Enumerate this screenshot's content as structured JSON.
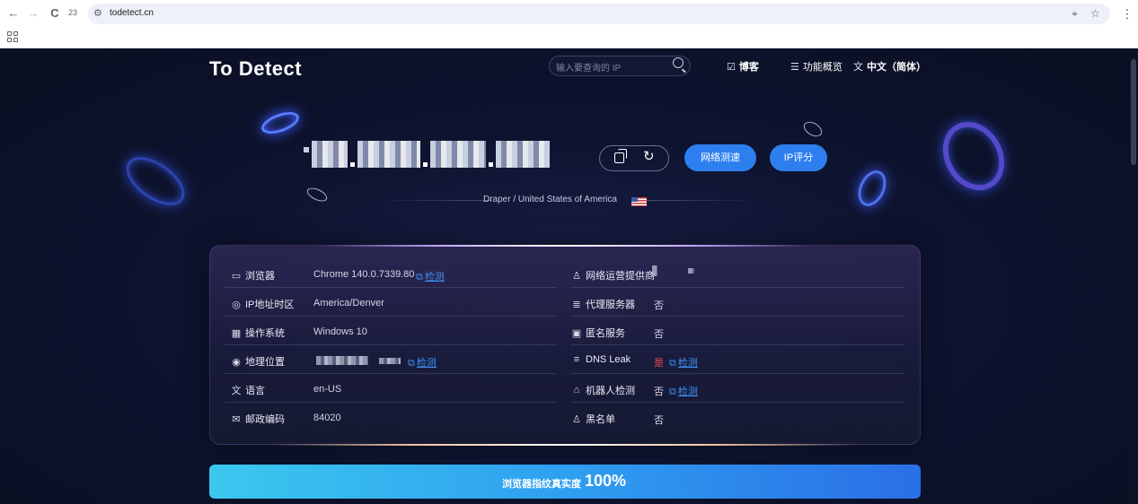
{
  "browser": {
    "back_icon": "←",
    "forward_icon": "→",
    "reload_icon": "C",
    "tab_count": "23",
    "url": "todetect.cn",
    "location_icon": "⌖",
    "star_icon": "☆",
    "menu_icon": "⋮"
  },
  "header": {
    "logo_to": "To",
    "logo_detect": " Detect",
    "search_placeholder": "输入要查询的 IP",
    "nav_blog": "博客",
    "nav_features": "功能概览",
    "nav_language": "中文（简体）",
    "blog_icon": "☑",
    "features_icon": "☰",
    "language_icon": "文"
  },
  "hero": {
    "refresh_icon": "↻",
    "speed_test_button": "网络测速",
    "ip_score_button": "IP评分",
    "location": "Draper / United States of America"
  },
  "info": {
    "left": [
      {
        "icon": "▭",
        "label": "浏览器",
        "value": "Chrome 140.0.7339.80",
        "link": "检测"
      },
      {
        "icon": "◎",
        "label": "IP地址时区",
        "value": "America/Denver"
      },
      {
        "icon": "▦",
        "label": "操作系统",
        "value": "Windows 10"
      },
      {
        "icon": "◉",
        "label": "地理位置",
        "value": "",
        "link": "检测"
      },
      {
        "icon": "文",
        "label": "语言",
        "value": "en-US"
      },
      {
        "icon": "✉",
        "label": "邮政编码",
        "value": "84020"
      }
    ],
    "right": [
      {
        "icon": "♙",
        "label": "网络运营提供商",
        "value": ""
      },
      {
        "icon": "≣",
        "label": "代理服务器",
        "value": "否"
      },
      {
        "icon": "▣",
        "label": "匿名服务",
        "value": "否"
      },
      {
        "icon": "≡",
        "label": "DNS Leak",
        "value": "是",
        "link": "检测"
      },
      {
        "icon": "⌂",
        "label": "机器人检测",
        "value": "否",
        "link": "检测"
      },
      {
        "icon": "♙",
        "label": "黑名单",
        "value": "否"
      }
    ],
    "link_icon": "⧉"
  },
  "fingerprint": {
    "label": "浏览器指纹真实度",
    "value": "100%"
  },
  "colors": {
    "accent": "#2d7ff0",
    "link": "#3f8ff5",
    "danger": "#e8484a"
  }
}
